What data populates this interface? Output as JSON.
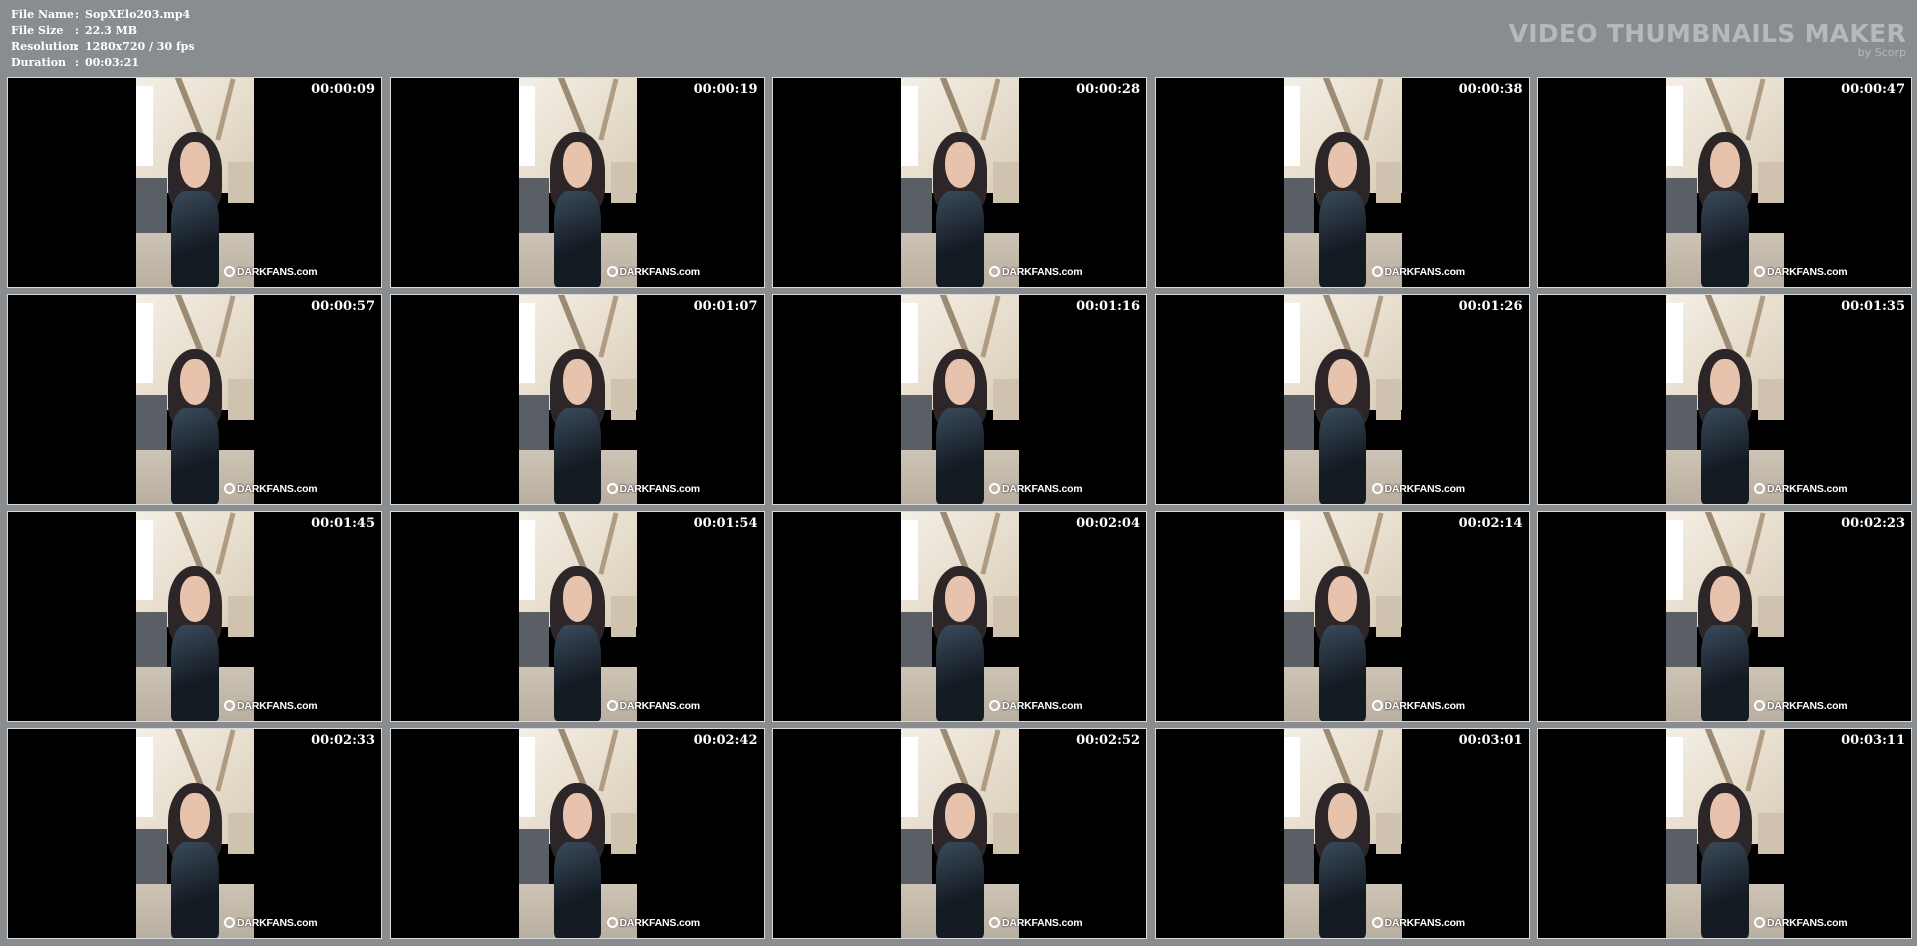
{
  "info": {
    "rows": [
      {
        "key": "File Name",
        "sep": ":",
        "value": "SopXElo203.mp4"
      },
      {
        "key": "File Size",
        "sep": ":",
        "value": "22.3 MB"
      },
      {
        "key": "Resolution",
        "sep": ":",
        "value": "1280x720 / 30 fps"
      },
      {
        "key": "Duration",
        "sep": ":",
        "value": "00:03:21"
      }
    ]
  },
  "brand": {
    "title": "VIDEO THUMBNAILS MAKER",
    "subtitle": "by Scorp"
  },
  "watermark": "DARKFANS.com",
  "thumbnails": [
    {
      "time": "00:00:09"
    },
    {
      "time": "00:00:19"
    },
    {
      "time": "00:00:28"
    },
    {
      "time": "00:00:38"
    },
    {
      "time": "00:00:47"
    },
    {
      "time": "00:00:57"
    },
    {
      "time": "00:01:07"
    },
    {
      "time": "00:01:16"
    },
    {
      "time": "00:01:26"
    },
    {
      "time": "00:01:35"
    },
    {
      "time": "00:01:45"
    },
    {
      "time": "00:01:54"
    },
    {
      "time": "00:02:04"
    },
    {
      "time": "00:02:14"
    },
    {
      "time": "00:02:23"
    },
    {
      "time": "00:02:33"
    },
    {
      "time": "00:02:42"
    },
    {
      "time": "00:02:52"
    },
    {
      "time": "00:03:01"
    },
    {
      "time": "00:03:11"
    }
  ]
}
